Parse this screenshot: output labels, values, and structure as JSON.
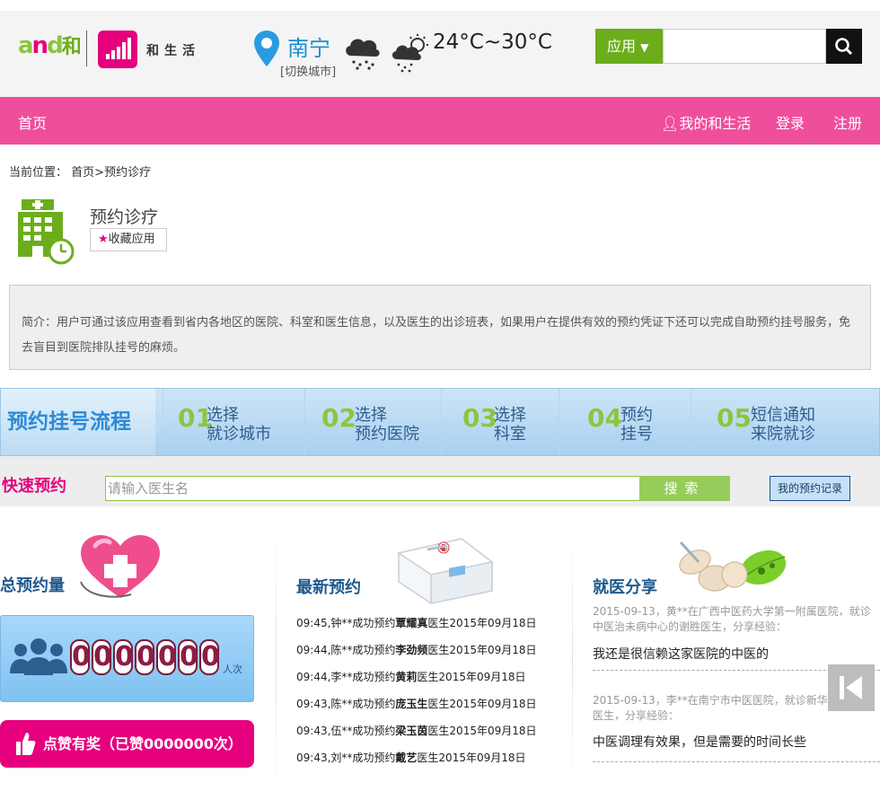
{
  "header": {
    "brand": "和生活",
    "logo_text": "and和",
    "city": "南宁",
    "switch_city": "[切换城市]",
    "temperature": "24°C~30°C",
    "app_menu_label": "应用",
    "search_value": ""
  },
  "nav": {
    "home": "首页",
    "my_life": "我的和生活",
    "login": "登录",
    "register": "注册"
  },
  "breadcrumb": {
    "prefix": "当前位置：",
    "home": "首页",
    "separator": ">",
    "current": "预约诊疗"
  },
  "app": {
    "title": "预约诊疗",
    "favorite_label": "收藏应用",
    "intro": "简介：用户可通过该应用查看到省内各地区的医院、科室和医生信息，以及医生的出诊班表，如果用户在提供有效的预约凭证下还可以完成自助预约挂号服务，免去盲目到医院排队挂号的麻烦。"
  },
  "flow": {
    "title": "预约挂号流程",
    "steps": [
      {
        "num": "01",
        "line1": "选择",
        "line2": "就诊城市"
      },
      {
        "num": "02",
        "line1": "选择",
        "line2": "预约医院"
      },
      {
        "num": "03",
        "line1": "选择",
        "line2": "科室"
      },
      {
        "num": "04",
        "line1": "预约",
        "line2": "挂号"
      },
      {
        "num": "05",
        "line1": "短信通知",
        "line2": "来院就诊"
      }
    ]
  },
  "quick": {
    "title": "快速预约",
    "placeholder": "请输入医生名",
    "search_label": "搜索",
    "record_label": "我的预约记录"
  },
  "stats": {
    "title": "总预约量",
    "digits": [
      "0",
      "0",
      "0",
      "0",
      "0",
      "0",
      "0"
    ],
    "unit": "人次",
    "like_label": "点赞有奖（已赞0000000次）"
  },
  "recent": {
    "title": "最新预约",
    "items": [
      {
        "pre": "09:45,钟**成功预约",
        "doctor": "覃耀真",
        "post": "医生2015年09月18日"
      },
      {
        "pre": "09:44,陈**成功预约",
        "doctor": "李劲频",
        "post": "医生2015年09月18日"
      },
      {
        "pre": "09:44,李**成功预约",
        "doctor": "黄莉",
        "post": "医生2015年09月18日"
      },
      {
        "pre": "09:43,陈**成功预约",
        "doctor": "庞玉生",
        "post": "医生2015年09月18日"
      },
      {
        "pre": "09:43,伍**成功预约",
        "doctor": "梁玉茵",
        "post": "医生2015年09月18日"
      },
      {
        "pre": "09:43,刘**成功预约",
        "doctor": "戴艺",
        "post": "医生2015年09月18日"
      }
    ]
  },
  "share": {
    "title": "就医分享",
    "items": [
      {
        "meta": "2015-09-13，黄**在广西中医药大学第一附属医院，就诊中医治未病中心的谢胜医生，分享经验：",
        "text": "我还是很信赖这家医院的中医的"
      },
      {
        "meta": "2015-09-13，李**在南宁市中医医院，就诊新华科的易蕾医生，分享经验：",
        "text": "中医调理有效果，但是需要的时间长些"
      }
    ]
  },
  "colors": {
    "nav_pink": "#ef4e9c",
    "brand_magenta": "#e6007e",
    "green": "#6cad1c",
    "blue_title": "#1e5a8c"
  }
}
